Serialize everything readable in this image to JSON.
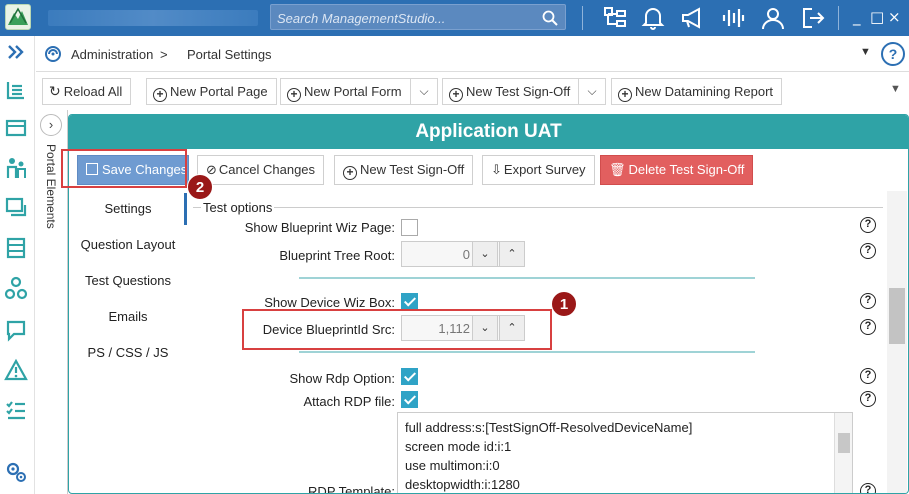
{
  "titlebar": {
    "search_placeholder": "Search ManagementStudio...",
    "window_controls": [
      "_",
      "□",
      "×"
    ],
    "icons": [
      "org-chart-icon",
      "bell-icon",
      "megaphone-icon",
      "waveform-icon",
      "user-icon",
      "logout-icon"
    ]
  },
  "breadcrumb": {
    "items": [
      "Administration",
      "Portal Settings"
    ],
    "separator": ">",
    "help": "?",
    "collapse": "▼"
  },
  "toolbar": {
    "reload_all": "Reload All",
    "new_portal_page": "New Portal Page",
    "new_portal_form": "New Portal Form",
    "new_test_signoff": "New Test Sign-Off",
    "new_datamining_report": "New Datamining Report",
    "dropdown": "⌵",
    "overflow": "▼"
  },
  "side_tab": {
    "label": "Portal Elements",
    "toggle": "›"
  },
  "panel": {
    "title": "Application UAT",
    "actions": {
      "save": "Save Changes",
      "cancel": "Cancel Changes",
      "new_test_signoff": "New Test Sign-Off",
      "export_survey": "Export Survey",
      "delete_test_signoff": "Delete Test Sign-Off"
    },
    "nav": [
      "Settings",
      "Question Layout",
      "Test Questions",
      "Emails",
      "PS / CSS / JS"
    ],
    "active_nav": "Settings",
    "section_title": "Test options",
    "fields": {
      "show_blueprint_wiz_page": {
        "label": "Show Blueprint Wiz Page:",
        "checked": false
      },
      "blueprint_tree_root": {
        "label": "Blueprint Tree Root:",
        "value": "0"
      },
      "show_device_wiz_box": {
        "label": "Show Device Wiz Box:",
        "checked": true
      },
      "device_blueprintid_src": {
        "label": "Device BlueprintId Src:",
        "value": "1,112"
      },
      "show_rdp_option": {
        "label": "Show Rdp Option:",
        "checked": true
      },
      "attach_rdp_file": {
        "label": "Attach RDP file:",
        "checked": true
      },
      "rdp_template": {
        "label": "RDP Template:",
        "lines": [
          "full address:s:[TestSignOff-ResolvedDeviceName]",
          "screen mode id:i:1",
          "use multimon:i:0",
          "desktopwidth:i:1280"
        ]
      }
    },
    "help_glyph": "?",
    "step_down": "⌄",
    "step_up": "⌃"
  },
  "annotations": {
    "badge_1": "1",
    "badge_2": "2",
    "highlight_color": "#d84040",
    "badge_color": "#9a1818"
  },
  "colors": {
    "titlebar": "#2c6fb3",
    "panel_accent": "#2fa3a6",
    "save_button": "#6f9bd1",
    "delete_button": "#e25f5f",
    "checkbox": "#2fa3c6"
  }
}
